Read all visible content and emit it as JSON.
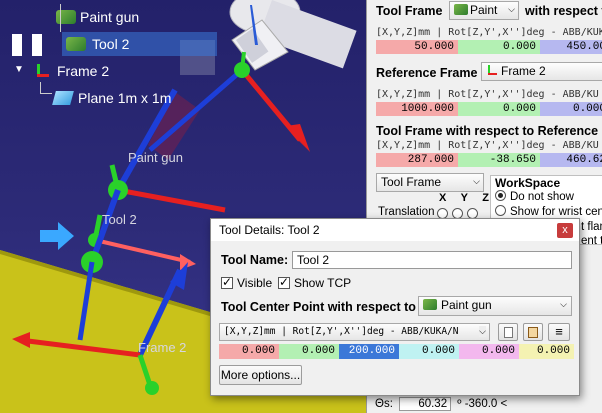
{
  "tree": {
    "items": [
      {
        "label": "Paint gun"
      },
      {
        "label": "Tool 2"
      },
      {
        "label": "Frame 2"
      },
      {
        "label": "Plane 1m x 1m"
      }
    ]
  },
  "viewport": {
    "labels": {
      "paint_gun": "Paint gun",
      "tool2": "Tool 2",
      "frame2": "Frame 2"
    }
  },
  "panel": {
    "tool_frame": {
      "title": "Tool Frame",
      "combo": "Paint",
      "suffix": "with respect t",
      "format": "[X,Y,Z]mm | Rot[Z,Y',X'']deg - ABB/KUKA/",
      "values": [
        "50.000",
        "0.000",
        "450.00"
      ]
    },
    "reference_frame": {
      "title": "Reference Frame",
      "combo": "Frame 2",
      "format": "[X,Y,Z]mm | Rot[Z,Y',X'']deg - ABB/KU",
      "values": [
        "1000.000",
        "0.000",
        "0.000"
      ]
    },
    "tool_wrt_ref": {
      "title": "Tool Frame with respect to Reference F",
      "format": "[X,Y,Z]mm | Rot[Z,Y',X'']deg - ABB/KU",
      "values": [
        "287.000",
        "-38.650",
        "460.62"
      ]
    },
    "jog": {
      "combo": "Tool Frame",
      "axes": [
        "X",
        "Y",
        "Z"
      ],
      "translation_label": "Translation"
    },
    "workspace": {
      "title": "WorkSpace",
      "options": [
        "Do not show",
        "Show for wrist cent",
        "t flan",
        "ent to"
      ]
    },
    "footer": {
      "label": "Θs:",
      "value": "60.32",
      "suffix": "º -360.0 <"
    }
  },
  "dialog": {
    "title": "Tool Details: Tool 2",
    "close": "x",
    "tool_name_label": "Tool Name:",
    "tool_name_value": "Tool 2",
    "visible_label": "Visible",
    "show_tcp_label": "Show TCP",
    "tcp_label": "Tool Center Point with respect to",
    "tcp_ref": "Paint gun",
    "format": "[X,Y,Z]mm | Rot[Z,Y',X'']deg - ABB/KUKA/N",
    "values": [
      "0.000",
      "0.000",
      "200.000",
      "0.000",
      "0.000",
      "0.000"
    ],
    "more_options": "More options..."
  },
  "colors": {
    "accent_selection": "#3b78d8",
    "dialog_close": "#c73c3c"
  }
}
